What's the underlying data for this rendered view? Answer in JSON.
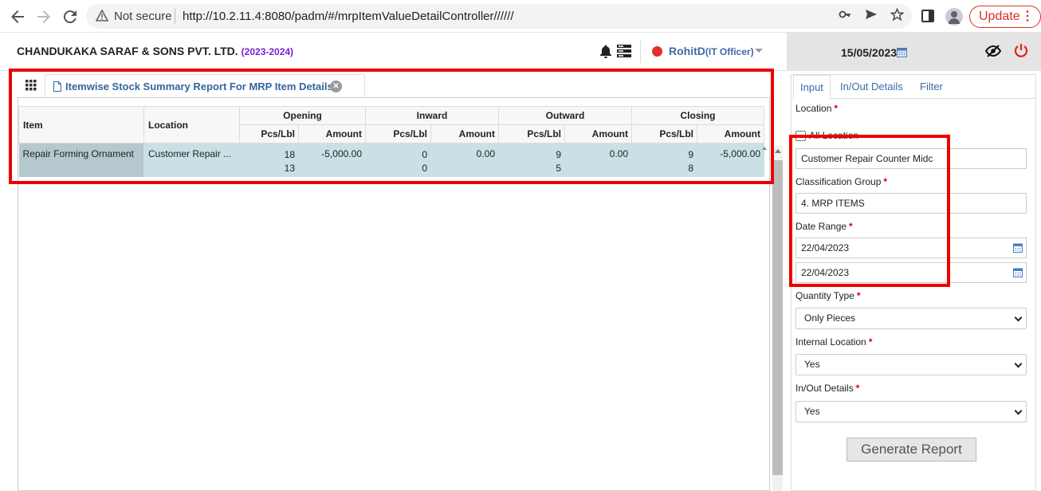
{
  "browser": {
    "security_label": "Not secure",
    "url": "http://10.2.11.4:8080/padm/#/mrpItemValueDetailController//////",
    "update_label": "Update"
  },
  "header": {
    "company": "CHANDUKAKA SARAF & SONS PVT. LTD.",
    "financial_year": "(2023-2024)",
    "user_name": "RohitD",
    "user_role": "(IT Officer)",
    "date": "15/05/2023"
  },
  "report": {
    "tab_title": "Itemwise Stock Summary Report For MRP Item Details",
    "columns": {
      "item": "Item",
      "location": "Location",
      "groups": [
        "Opening",
        "Inward",
        "Outward",
        "Closing"
      ],
      "pcs": "Pcs/Lbl",
      "amount": "Amount"
    },
    "rows": [
      {
        "item": "Repair Forming Ornament",
        "location": "Customer Repair ...",
        "opening_pcs": [
          "18",
          "13"
        ],
        "opening_amount": "-5,000.00",
        "inward_pcs": [
          "0",
          "0"
        ],
        "inward_amount": "0.00",
        "outward_pcs": [
          "9",
          "5"
        ],
        "outward_amount": "0.00",
        "closing_pcs": [
          "9",
          "8"
        ],
        "closing_amount": "-5,000.00"
      }
    ]
  },
  "form": {
    "tabs": [
      "Input",
      "In/Out Details",
      "Filter"
    ],
    "location_label": "Location",
    "all_location_label": "All Location",
    "location_value": "Customer Repair Counter Midc",
    "classification_label": "Classification Group",
    "classification_value": "4. MRP ITEMS",
    "date_range_label": "Date Range",
    "date_from": "22/04/2023",
    "date_to": "22/04/2023",
    "quantity_type_label": "Quantity Type",
    "quantity_type_value": "Only Pieces",
    "internal_location_label": "Internal Location",
    "internal_location_value": "Yes",
    "inout_details_label": "In/Out Details",
    "inout_details_value": "Yes",
    "generate_label": "Generate Report",
    "required_mark": "*"
  },
  "colors": {
    "highlight": "#ee0000",
    "row_bg": "#c9e0e5",
    "link_blue": "#3f6aa8"
  },
  "icons": [
    "back-arrow-icon",
    "forward-arrow-icon",
    "reload-icon",
    "warning-icon",
    "key-icon",
    "send-icon",
    "star-icon",
    "extensions-icon",
    "profile-icon",
    "bell-icon",
    "server-icon",
    "calendar-icon",
    "eye-slash-icon",
    "power-icon",
    "grid-icon",
    "document-icon",
    "close-icon",
    "dropdown-arrow-icon"
  ]
}
